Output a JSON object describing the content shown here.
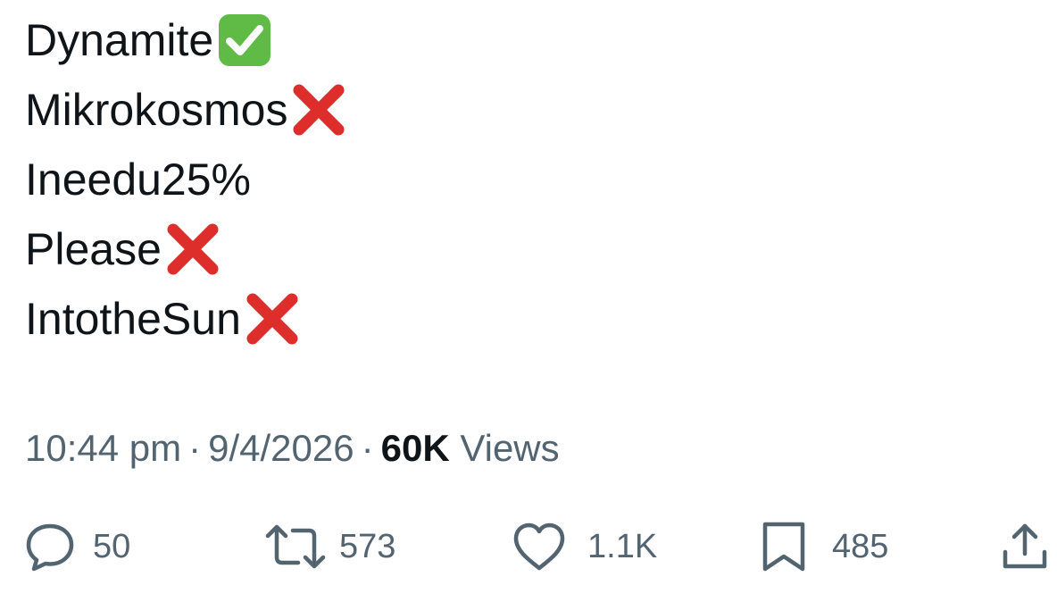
{
  "tweet": {
    "lines": [
      {
        "text": "Dynamite",
        "mark": "check-mark-button-icon"
      },
      {
        "text": "Mikrokosmos",
        "mark": "cross-mark-icon"
      },
      {
        "text": "Ineedu25%",
        "mark": ""
      },
      {
        "text": "Please",
        "mark": "cross-mark-icon"
      },
      {
        "text": "IntotheSun",
        "mark": "cross-mark-icon"
      }
    ]
  },
  "meta": {
    "time": "10:44 pm",
    "separator": "·",
    "date": "9/4/2026",
    "views_count": "60K",
    "views_label": "Views"
  },
  "actions": {
    "replies": {
      "icon": "reply-icon",
      "count": "50"
    },
    "retweets": {
      "icon": "retweet-icon",
      "count": "573"
    },
    "likes": {
      "icon": "heart-icon",
      "count": "1.1K"
    },
    "bookmarks": {
      "icon": "bookmark-icon",
      "count": "485"
    },
    "share": {
      "icon": "share-icon"
    }
  },
  "colors": {
    "text": "#0f1419",
    "secondary": "#536471",
    "check_green": "#5fba46",
    "cross_red": "#dd2e2b"
  }
}
